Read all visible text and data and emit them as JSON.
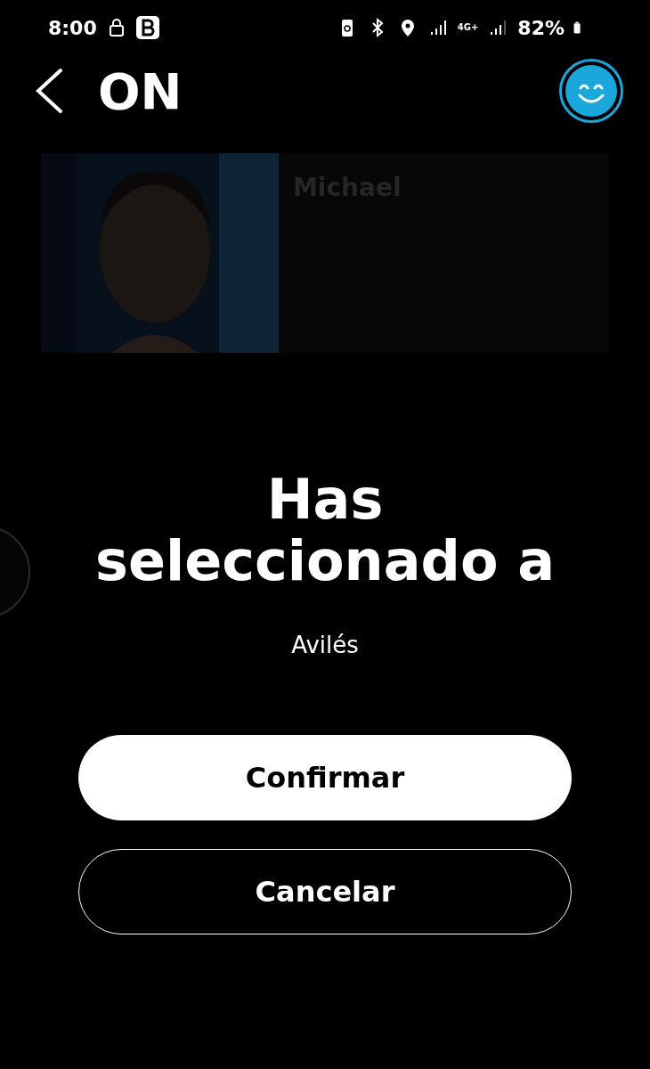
{
  "status_bar": {
    "time": "8:00",
    "battery": "82%",
    "network": "4G+"
  },
  "header": {
    "title": "ON"
  },
  "card": {
    "kind": "picture",
    "name": "Michael"
  },
  "dialog": {
    "title": "Has seleccionado a",
    "subtitle": "Avilés",
    "buttons": [
      {
        "label": "Confirmar",
        "kind": "primary"
      },
      {
        "label": "Cancelar",
        "kind": "outline"
      }
    ]
  }
}
